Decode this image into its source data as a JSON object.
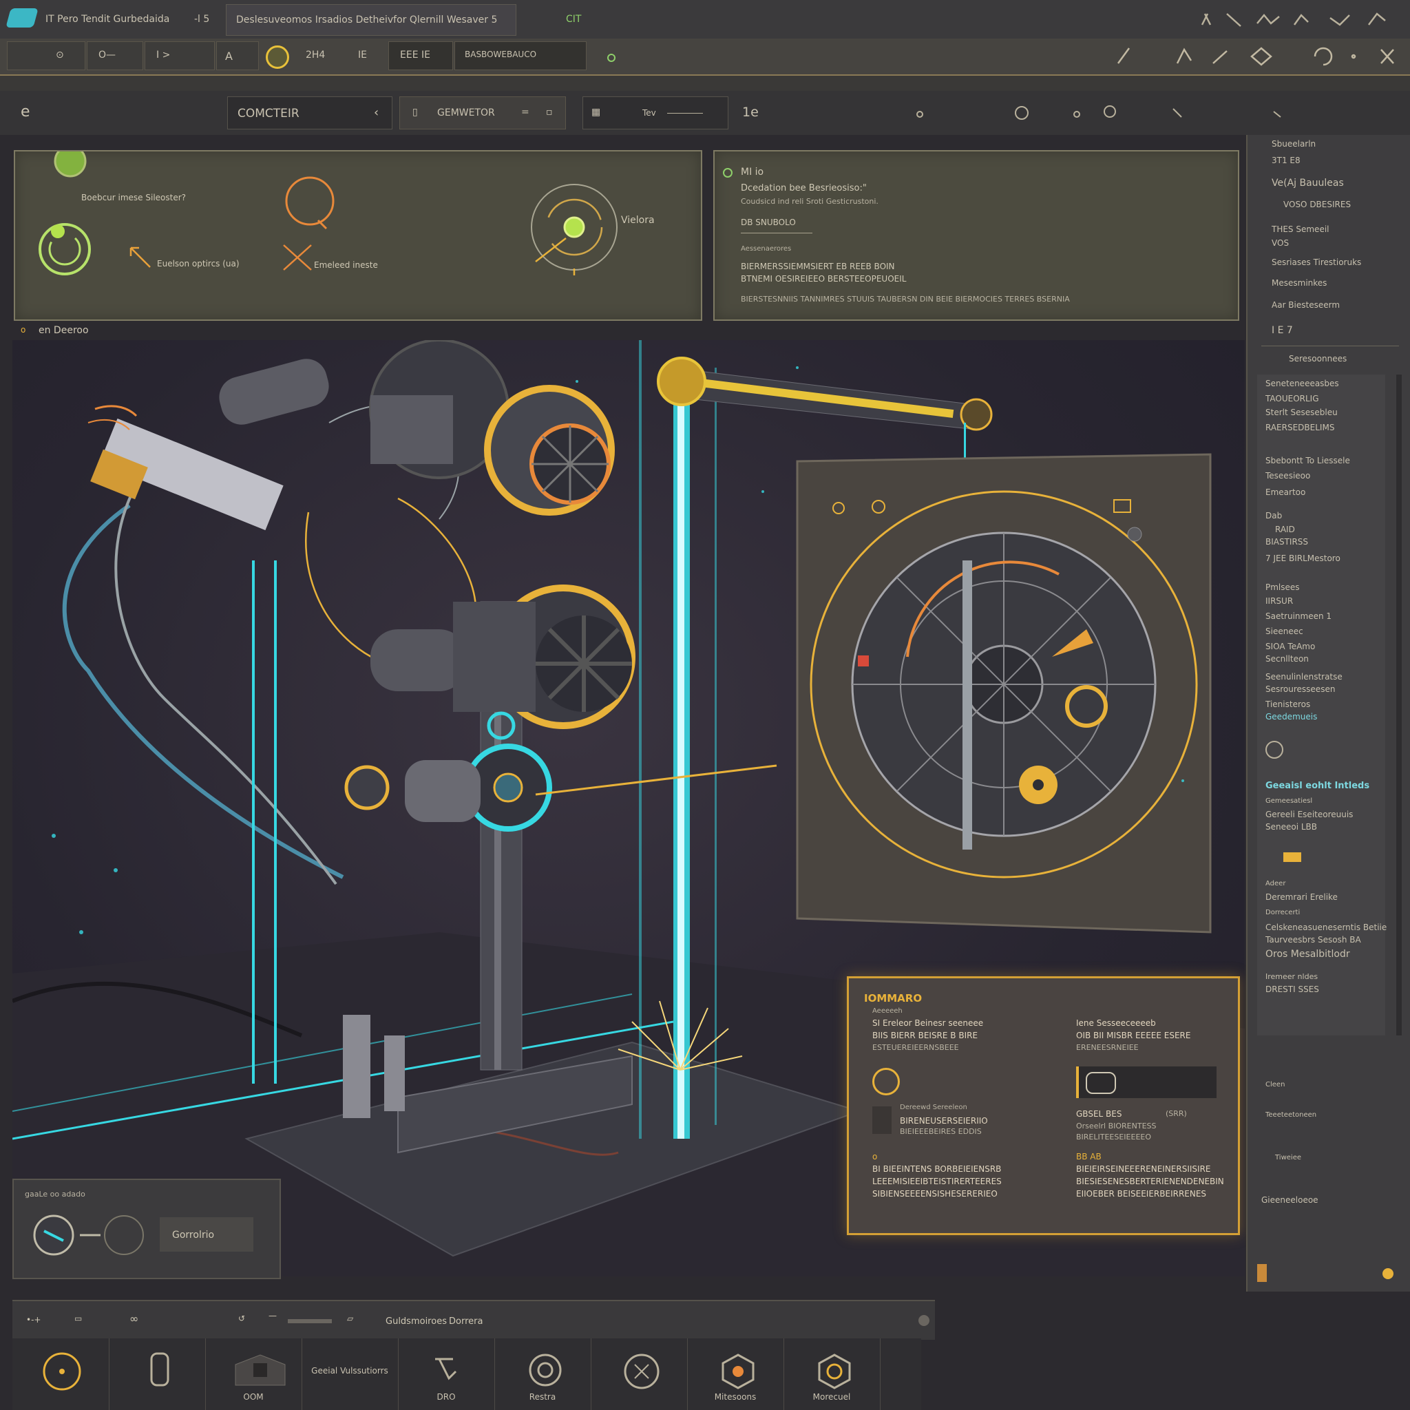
{
  "titlebar": {
    "app_title": "IT Pero Tendit Gurbedaida",
    "tab_counter": "-l 5",
    "window_title": "Deslesuveomos Irsadios Detheivfor Qlernill Wesaver 5",
    "tab_tag": "CIT"
  },
  "toolbar": {
    "items": [
      "O—",
      "I >",
      "A",
      "2H4",
      "IE",
      "EEE IE"
    ],
    "active_tool": "BASBOWEBAUCO"
  },
  "menubar": {
    "left_icon": "e",
    "section": "COMCTEIR",
    "generator_tab": "GEMWETOR",
    "field_label": "Tev",
    "field_value": "1e"
  },
  "top_panel_left": {
    "label_1": "Boebcur imese Sileoster?",
    "label_2": "Euelson optircs (ua)",
    "label_3": "Emeleed ineste",
    "label_4": "Vielora"
  },
  "top_panel_right": {
    "title": "MI io",
    "subtitle": "Dcedation bee Besrieosiso:\"",
    "desc": "Coudsicd ind reli Sroti Gesticrustoni.",
    "section": "DB SNUBOLO",
    "small_label": "Aessenaerores",
    "line_1": "BIERMERSSIEMMSIERT EB REEB BOIN",
    "line_2": "BTNEMI OESIREIEEO BERSTEEOPEUOEIL",
    "line_3": "BIERSTESNNIIS TANNIMRES STUUIS TAUBERSN DIN BEIE BIERMOCIES TERRES BSERNIA"
  },
  "viewport_header": "en Deeroo",
  "right_panel": {
    "items_a": [
      "Sbueelarln",
      "3T1 E8",
      "Ve(Aj Bauuleas",
      "VOSO DBESIRES",
      "THES Semeeil",
      "VOS",
      "Sesriases Tirestioruks",
      "Mesesminkes",
      "Aar Biesteseerm",
      "I E 7"
    ],
    "section_b": "Seresoonnees",
    "items_b": [
      "Seneteneeeasbes",
      "TAOUEORLIG",
      "Sterlt Sesesebleu",
      "RAERSEDBELIMS",
      "Sbebontt To Liessele",
      "Teseesieoo",
      "Emeartoo",
      "Dab",
      "RAID",
      "BIASTIRSS",
      "7 JEE BIRLMestoro",
      "Pmlsees",
      "IIRSUR",
      "Saetruinmeen 1",
      "Sieeneec",
      "SIOA TeAmo",
      "Secnllteon",
      "Seenulinlenstratse",
      "Sesrouresseesen",
      "Tienisteros",
      "Geedemueis"
    ],
    "highlight": "Geeaisl eohlt Intleds",
    "items_c": [
      "Gemeesatiesl",
      "Gereeli Eseiteoreuuis",
      "Seneeoi LBB",
      "Adeer",
      "Deremrari Erelike",
      "Dorrecerti",
      "Celskeneasueneserntis Betiie",
      "Taurveesbrs Sesosh BA",
      "Oros Mesalbitlodr",
      "Iremeer nldes",
      "DRESTI SSES"
    ],
    "items_d": [
      "Cleen",
      "Teeeteetoneen",
      "Tiweiee",
      "Gieeneeloeoe"
    ]
  },
  "generator_panel": {
    "title": "IOMMARO",
    "sub": "Aeeeeeh",
    "left_lines": [
      "SI Ereleor Beinesr seeneee",
      "BIIS BIERR BEISRE B BIRE",
      "ESTEUEREIEERNSBEEE"
    ],
    "right_lines": [
      "Iene Sesseeceeeeb",
      "OIB BII MISBR EEEEE ESERE",
      "ERENEESRNEIEE"
    ],
    "caption_a": "Dereewd Sereeleon",
    "left_lines_2": [
      "BIRENEUSERSEIERIIO",
      "BIEIEEEBEIRES EDDIS"
    ],
    "right_label": "GBSEL BES",
    "right_tag": "(SRR)",
    "right_lines_2": [
      "Orseelrl BIORENTESS",
      "BIRELITEESEIEEEEO"
    ],
    "footer_left_tag": "o",
    "footer_left": [
      "BI BIEEINTENS BORBEIEIENSRB",
      "LEEEMISIEEIBTEISTIRERTEERES",
      "SIBIENSEEEENSISHESERERIEO"
    ],
    "footer_right_tag": "BB AB",
    "footer_right": [
      "BIEIEIRSEINEEERENEINERSIISIRE",
      "BIESIESENESBERTERIENENDENEBIN",
      "EIIOEBER BEISEEIERBEIRRENES"
    ]
  },
  "mini_window": {
    "header": "gaaLe oo adado",
    "label": "Gorrolrio"
  },
  "bottombar": {
    "label_1": "Guldsmoiroes",
    "label_2": "Dorrera"
  },
  "bottom_tools": [
    {
      "label": ""
    },
    {
      "label": ""
    },
    {
      "label": "OOM"
    },
    {
      "label": "Geeial Vulssutiorrs"
    },
    {
      "label": "DRO"
    },
    {
      "label": "Restra"
    },
    {
      "label": ""
    },
    {
      "label": "Mitesoons"
    },
    {
      "label": "Morecuel"
    }
  ],
  "colors": {
    "accent_gold": "#e8b23a",
    "accent_cyan": "#37d8e2",
    "accent_green": "#a6e243",
    "accent_orange": "#e8893a"
  }
}
